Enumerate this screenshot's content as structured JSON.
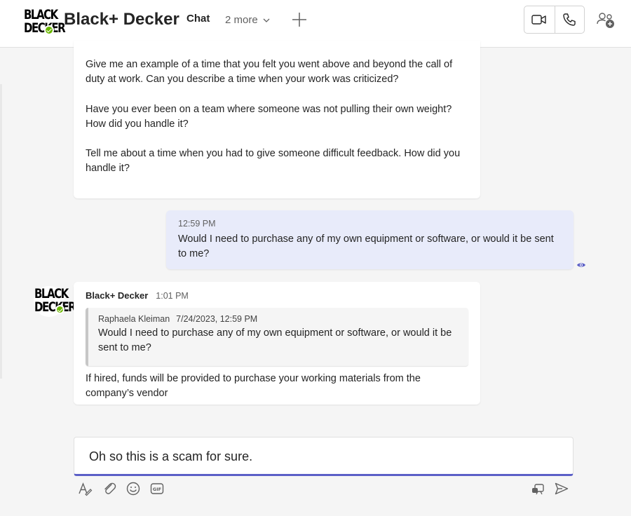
{
  "header": {
    "logo_text": "BLACK DECKER",
    "title": "Black+ Decker",
    "tabs": [
      {
        "label": "Chat",
        "active": true
      }
    ],
    "more_label": "2 more",
    "icons": {
      "chevron": "chevron-down-icon",
      "add_tab": "plus-icon",
      "video": "video-camera-icon",
      "call": "phone-icon",
      "people": "people-add-icon"
    }
  },
  "messages": [
    {
      "paragraphs": [
        "Give me an example of a time that you felt you went above and beyond the call of duty at work. Can you describe a time when your work was criticized?",
        "Have you ever been on a team where someone was not pulling their own weight? How did you handle it?",
        "Tell me about a time when you had to give someone difficult feedback. How did you handle it?"
      ]
    },
    {
      "time": "12:59 PM",
      "text": "Would I need to purchase any of my own equipment or software, or would it be sent to me?",
      "status_icon": "seen-eye-icon"
    },
    {
      "sender": "Black+ Decker",
      "time": "1:01 PM",
      "quote": {
        "author": "Raphaela Kleiman",
        "timestamp": "7/24/2023, 12:59 PM",
        "text": "Would I need to purchase any of my own equipment or software, or would it be sent to me?"
      },
      "text": "If hired, funds will be provided to purchase your working materials from the company’s vendor"
    }
  ],
  "compose": {
    "value": "Oh so this is a scam for sure.",
    "toolbar_icons": [
      "format-icon",
      "attach-icon",
      "emoji-icon",
      "gif-icon",
      "loop-icon",
      "send-icon"
    ]
  },
  "colors": {
    "accent": "#5b5fc7",
    "own_bubble": "#e8ebfa",
    "presence": "#6bb700"
  }
}
